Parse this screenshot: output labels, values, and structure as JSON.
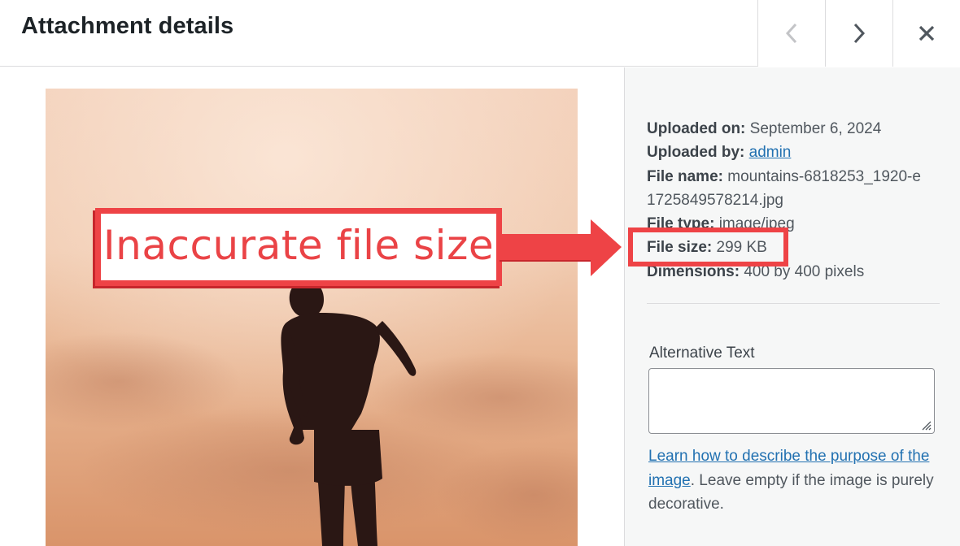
{
  "header": {
    "title": "Attachment details",
    "prev_icon": "chevron-left-icon",
    "next_icon": "chevron-right-icon",
    "close_icon": "close-icon"
  },
  "details": {
    "uploaded_on_label": "Uploaded on:",
    "uploaded_on_value": "September 6, 2024",
    "uploaded_by_label": "Uploaded by:",
    "uploaded_by_value": "admin",
    "file_name_label": "File name:",
    "file_name_value": "mountains-6818253_1920-e1725849578214.jpg",
    "file_type_label": "File type:",
    "file_type_value": "image/jpeg",
    "file_size_label": "File size:",
    "file_size_value": "299 KB",
    "dimensions_label": "Dimensions:",
    "dimensions_value": "400 by 400 pixels"
  },
  "alt_text": {
    "label": "Alternative Text",
    "value": "",
    "help_link": "Learn how to describe the purpose of the image",
    "help_rest": ". Leave empty if the image is purely decorative."
  },
  "annotation": {
    "callout_text": "Inaccurate file size",
    "color": "#ee4346"
  },
  "colors": {
    "link": "#2271b1",
    "sidebar_bg": "#f6f7f7"
  }
}
